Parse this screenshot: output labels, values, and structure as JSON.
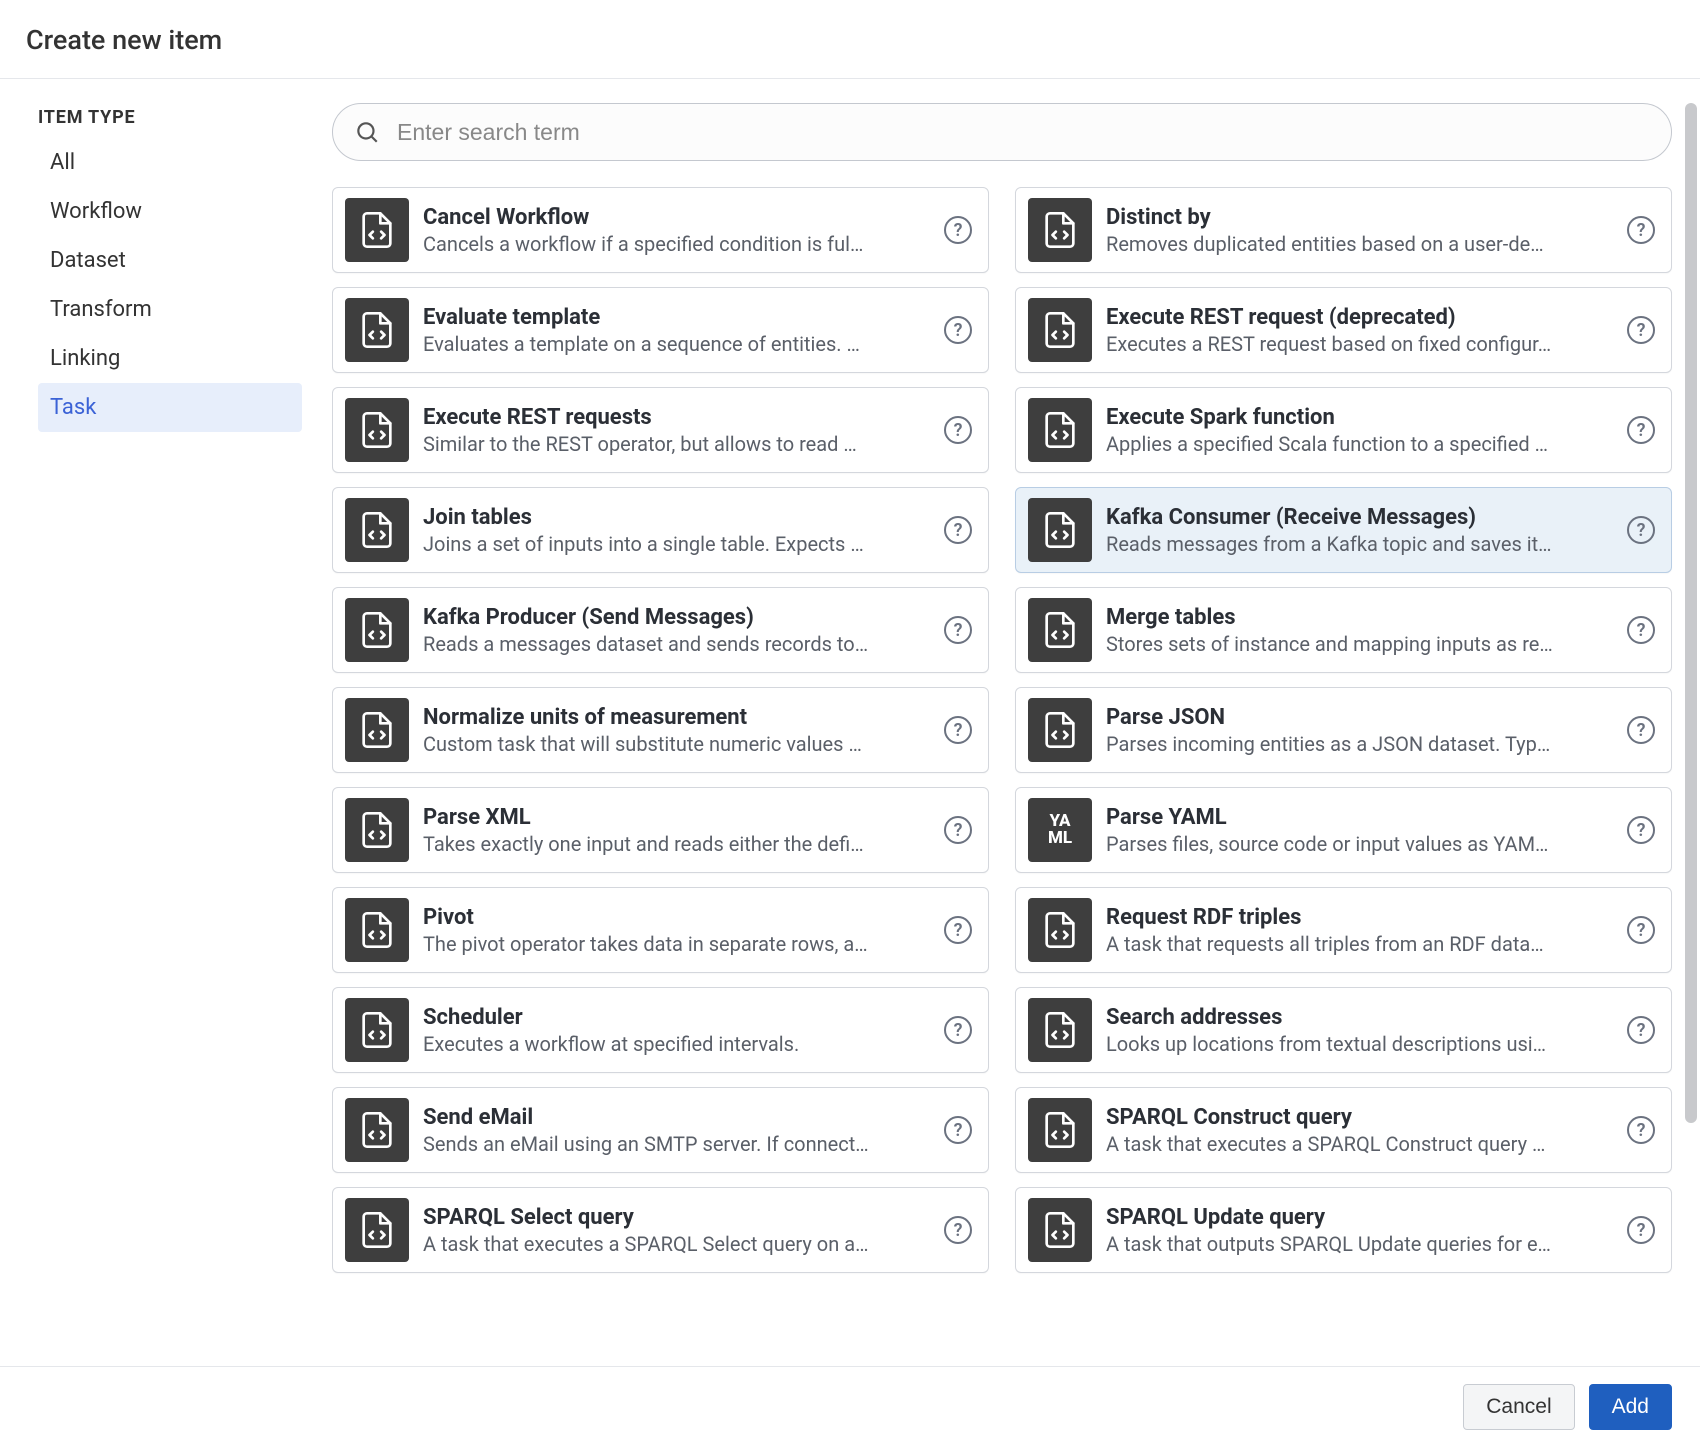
{
  "dialog": {
    "title": "Create new item"
  },
  "sidebar": {
    "heading": "ITEM TYPE",
    "items": [
      {
        "label": "All",
        "active": false
      },
      {
        "label": "Workflow",
        "active": false
      },
      {
        "label": "Dataset",
        "active": false
      },
      {
        "label": "Transform",
        "active": false
      },
      {
        "label": "Linking",
        "active": false
      },
      {
        "label": "Task",
        "active": true
      }
    ]
  },
  "search": {
    "placeholder": "Enter search term",
    "value": ""
  },
  "cards": [
    {
      "title": "Cancel Workflow",
      "desc": "Cancels a workflow if a specified condition is ful…",
      "icon": "code-file",
      "highlighted": false
    },
    {
      "title": "Distinct by",
      "desc": "Removes duplicated entities based on a user-de…",
      "icon": "code-file",
      "highlighted": false
    },
    {
      "title": "Evaluate template",
      "desc": "Evaluates a template on a sequence of entities. …",
      "icon": "code-file",
      "highlighted": false
    },
    {
      "title": "Execute REST request (deprecated)",
      "desc": "Executes a REST request based on fixed configur…",
      "icon": "code-file",
      "highlighted": false
    },
    {
      "title": "Execute REST requests",
      "desc": "Similar to the REST operator, but allows to read …",
      "icon": "code-file",
      "highlighted": false
    },
    {
      "title": "Execute Spark function",
      "desc": "Applies a specified Scala function to a specified …",
      "icon": "code-file",
      "highlighted": false
    },
    {
      "title": "Join tables",
      "desc": "Joins a set of inputs into a single table. Expects …",
      "icon": "code-file",
      "highlighted": false
    },
    {
      "title": "Kafka Consumer (Receive Messages)",
      "desc": "Reads messages from a Kafka topic and saves it…",
      "icon": "code-file",
      "highlighted": true
    },
    {
      "title": "Kafka Producer (Send Messages)",
      "desc": "Reads a messages dataset and sends records to…",
      "icon": "code-file",
      "highlighted": false
    },
    {
      "title": "Merge tables",
      "desc": "Stores sets of instance and mapping inputs as re…",
      "icon": "code-file",
      "highlighted": false
    },
    {
      "title": "Normalize units of measurement",
      "desc": "Custom task that will substitute numeric values …",
      "icon": "code-file",
      "highlighted": false
    },
    {
      "title": "Parse JSON",
      "desc": "Parses incoming entities as a JSON dataset. Typ…",
      "icon": "code-file",
      "highlighted": false
    },
    {
      "title": "Parse XML",
      "desc": "Takes exactly one input and reads either the defi…",
      "icon": "code-file",
      "highlighted": false
    },
    {
      "title": "Parse YAML",
      "desc": "Parses files, source code or input values as YAM…",
      "icon": "yaml",
      "highlighted": false
    },
    {
      "title": "Pivot",
      "desc": "The pivot operator takes data in separate rows, a…",
      "icon": "code-file",
      "highlighted": false
    },
    {
      "title": "Request RDF triples",
      "desc": "A task that requests all triples from an RDF data…",
      "icon": "code-file",
      "highlighted": false
    },
    {
      "title": "Scheduler",
      "desc": "Executes a workflow at specified intervals.",
      "icon": "code-file",
      "highlighted": false
    },
    {
      "title": "Search addresses",
      "desc": "Looks up locations from textual descriptions usi…",
      "icon": "code-file",
      "highlighted": false
    },
    {
      "title": "Send eMail",
      "desc": "Sends an eMail using an SMTP server. If connect…",
      "icon": "code-file",
      "highlighted": false
    },
    {
      "title": "SPARQL Construct query",
      "desc": "A task that executes a SPARQL Construct query …",
      "icon": "code-file",
      "highlighted": false
    },
    {
      "title": "SPARQL Select query",
      "desc": "A task that executes a SPARQL Select query on a…",
      "icon": "code-file",
      "highlighted": false
    },
    {
      "title": "SPARQL Update query",
      "desc": "A task that outputs SPARQL Update queries for e…",
      "icon": "code-file",
      "highlighted": false
    }
  ],
  "footer": {
    "cancel": "Cancel",
    "add": "Add"
  },
  "help_glyph": "?"
}
